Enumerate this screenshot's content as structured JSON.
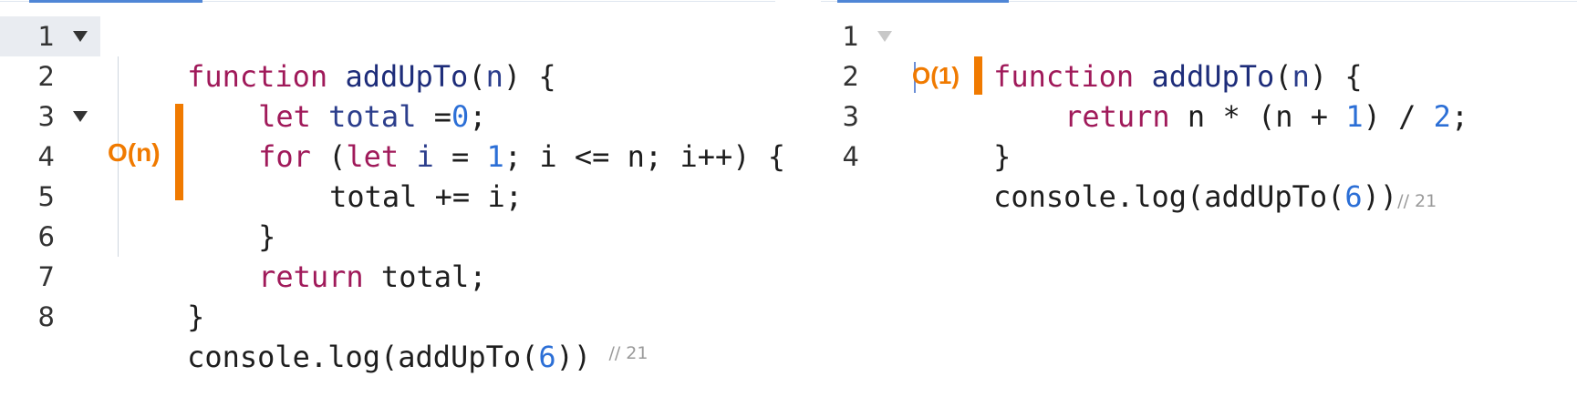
{
  "left_editor": {
    "lines": [
      {
        "num": "1"
      },
      {
        "num": "2"
      },
      {
        "num": "3"
      },
      {
        "num": "4"
      },
      {
        "num": "5"
      },
      {
        "num": "6"
      },
      {
        "num": "7"
      },
      {
        "num": "8"
      }
    ],
    "code": {
      "l1": {
        "kw": "function",
        "fn": "addUpTo",
        "open": "(",
        "param": "n",
        "close": ") {"
      },
      "l2": {
        "kw": "let",
        "var": "total",
        "rest": " =",
        "num": "0",
        "end": ";"
      },
      "l3": {
        "kw": "for",
        "open": " (",
        "kw2": "let",
        "var": "i",
        "eq": " = ",
        "num": "1",
        "rest": "; i <= n; i++) {"
      },
      "l4": {
        "text": "total += i;"
      },
      "l5": {
        "text": "}"
      },
      "l6": {
        "kw": "return",
        "rest": " total;"
      },
      "l7": {
        "text": "}"
      },
      "l8": {
        "pre": "console.log(addUpTo(",
        "num": "6",
        "post": "))",
        "comment": "// 21"
      }
    },
    "complexity": "O(n)"
  },
  "right_editor": {
    "lines": [
      {
        "num": "1"
      },
      {
        "num": "2"
      },
      {
        "num": "3"
      },
      {
        "num": "4"
      }
    ],
    "code": {
      "l1": {
        "kw": "function",
        "fn": "addUpTo",
        "open": "(",
        "param": "n",
        "close": ") {"
      },
      "l2": {
        "kw": "return",
        "mid": " n * (n + ",
        "num1": "1",
        "mid2": ") / ",
        "num2": "2",
        "end": ";"
      },
      "l3": {
        "text": "}"
      },
      "l4": {
        "pre": "console.log(addUpTo(",
        "num": "6",
        "post": "))",
        "comment": "// 21"
      }
    },
    "complexity": "O(1)"
  },
  "colors": {
    "keyword": "#a01a5a",
    "function_name": "#1e2d7a",
    "number": "#2c6fd6",
    "complexity_accent": "#f07a00",
    "tab_indicator": "#4f86d6"
  }
}
